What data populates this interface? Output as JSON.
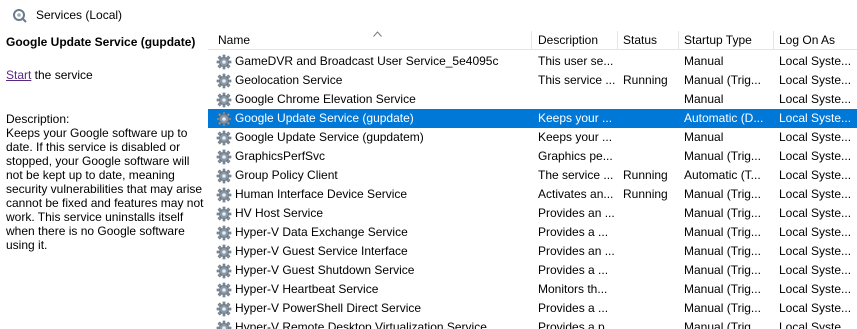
{
  "window": {
    "title": "Services (Local)"
  },
  "details": {
    "service_title": "Google Update Service (gupdate)",
    "start_link": "Start",
    "start_suffix": " the service",
    "description_label": "Description:",
    "description_text": "Keeps your Google software up to date. If this service is disabled or stopped, your Google software will not be kept up to date, meaning security vulnerabilities that may arise cannot be fixed and features may not work. This service uninstalls itself when there is no Google software using it."
  },
  "columns": {
    "name": "Name",
    "description": "Description",
    "status": "Status",
    "startup_type": "Startup Type",
    "log_on_as": "Log On As"
  },
  "sorted_column": "name",
  "services": [
    {
      "name": "GameDVR and Broadcast User Service_5e4095c",
      "description": "This user se...",
      "status": "",
      "startup_type": "Manual",
      "log_on_as": "Local Syste...",
      "selected": false
    },
    {
      "name": "Geolocation Service",
      "description": "This service ...",
      "status": "Running",
      "startup_type": "Manual (Trig...",
      "log_on_as": "Local Syste...",
      "selected": false
    },
    {
      "name": "Google Chrome Elevation Service",
      "description": "",
      "status": "",
      "startup_type": "Manual",
      "log_on_as": "Local Syste...",
      "selected": false
    },
    {
      "name": "Google Update Service (gupdate)",
      "description": "Keeps your ...",
      "status": "",
      "startup_type": "Automatic (D...",
      "log_on_as": "Local Syste...",
      "selected": true
    },
    {
      "name": "Google Update Service (gupdatem)",
      "description": "Keeps your ...",
      "status": "",
      "startup_type": "Manual",
      "log_on_as": "Local Syste...",
      "selected": false
    },
    {
      "name": "GraphicsPerfSvc",
      "description": "Graphics pe...",
      "status": "",
      "startup_type": "Manual (Trig...",
      "log_on_as": "Local Syste...",
      "selected": false
    },
    {
      "name": "Group Policy Client",
      "description": "The service ...",
      "status": "Running",
      "startup_type": "Automatic (T...",
      "log_on_as": "Local Syste...",
      "selected": false
    },
    {
      "name": "Human Interface Device Service",
      "description": "Activates an...",
      "status": "Running",
      "startup_type": "Manual (Trig...",
      "log_on_as": "Local Syste...",
      "selected": false
    },
    {
      "name": "HV Host Service",
      "description": "Provides an ...",
      "status": "",
      "startup_type": "Manual (Trig...",
      "log_on_as": "Local Syste...",
      "selected": false
    },
    {
      "name": "Hyper-V Data Exchange Service",
      "description": "Provides a ...",
      "status": "",
      "startup_type": "Manual (Trig...",
      "log_on_as": "Local Syste...",
      "selected": false
    },
    {
      "name": "Hyper-V Guest Service Interface",
      "description": "Provides an ...",
      "status": "",
      "startup_type": "Manual (Trig...",
      "log_on_as": "Local Syste...",
      "selected": false
    },
    {
      "name": "Hyper-V Guest Shutdown Service",
      "description": "Provides a ...",
      "status": "",
      "startup_type": "Manual (Trig...",
      "log_on_as": "Local Syste...",
      "selected": false
    },
    {
      "name": "Hyper-V Heartbeat Service",
      "description": "Monitors th...",
      "status": "",
      "startup_type": "Manual (Trig...",
      "log_on_as": "Local Syste...",
      "selected": false
    },
    {
      "name": "Hyper-V PowerShell Direct Service",
      "description": "Provides a ...",
      "status": "",
      "startup_type": "Manual (Trig...",
      "log_on_as": "Local Syste...",
      "selected": false
    },
    {
      "name": "Hyper-V Remote Desktop Virtualization Service",
      "description": "Provides a p...",
      "status": "",
      "startup_type": "Manual (Trig...",
      "log_on_as": "Local Syste...",
      "selected": false
    }
  ],
  "colors": {
    "selection": "#0078d7",
    "link": "#5a2a82",
    "header_divider": "#e5e5e5"
  },
  "icons": {
    "window": "services-gear-icon",
    "row": "service-gear-icon",
    "sort": "sort-ascending-icon"
  }
}
